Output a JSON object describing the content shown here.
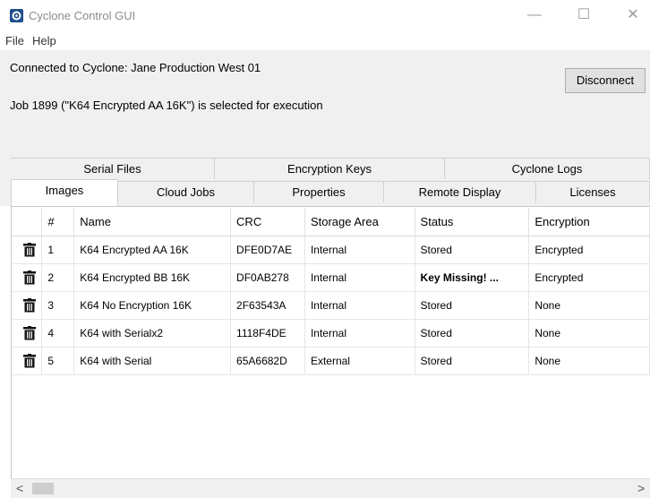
{
  "window": {
    "title": "Cyclone Control GUI",
    "minimize_glyph": "—",
    "maximize_glyph": "☐",
    "close_glyph": "✕",
    "icon": "cyclone-logo-icon"
  },
  "menu": [
    "File",
    "Help"
  ],
  "status": {
    "connected_text": "Connected to Cyclone: Jane Production West 01",
    "job_text": "Job 1899 (\"K64 Encrypted AA 16K\") is selected for execution",
    "disconnect_label": "Disconnect"
  },
  "tabs_row1": [
    "Serial Files",
    "Encryption Keys",
    "Cyclone Logs"
  ],
  "tabs_row2": [
    "Images",
    "Cloud Jobs",
    "Properties",
    "Remote Display",
    "Licenses"
  ],
  "active_tab": "Images",
  "table": {
    "columns": [
      "",
      "#",
      "Name",
      "CRC",
      "Storage Area",
      "Status",
      "Encryption"
    ],
    "rows": [
      {
        "num": "1",
        "name": "K64 Encrypted AA 16K",
        "crc": "DFE0D7AE",
        "storage": "Internal",
        "status": "Stored",
        "encryption": "Encrypted"
      },
      {
        "num": "2",
        "name": "K64 Encrypted BB 16K",
        "crc": "DF0AB278",
        "storage": "Internal",
        "status": "Key Missing! ...",
        "encryption": "Encrypted"
      },
      {
        "num": "3",
        "name": "K64 No Encryption 16K",
        "crc": "2F63543A",
        "storage": "Internal",
        "status": "Stored",
        "encryption": "None"
      },
      {
        "num": "4",
        "name": "K64 with Serialx2",
        "crc": "1118F4DE",
        "storage": "Internal",
        "status": "Stored",
        "encryption": "None"
      },
      {
        "num": "5",
        "name": "K64 with Serial",
        "crc": "65A6682D",
        "storage": "External",
        "status": "Stored",
        "encryption": "None"
      }
    ],
    "delete_icon": "trash-icon"
  },
  "scrollbar": {
    "left_glyph": "<",
    "right_glyph": ">"
  }
}
